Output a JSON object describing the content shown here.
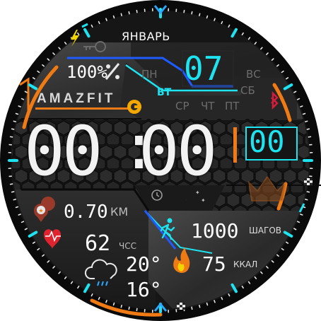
{
  "month": "ЯНВАРЬ",
  "battery": "100%",
  "brand": "AMAZFIT",
  "date_number": "07",
  "weekdays": {
    "mon": "ПН",
    "tue": "ВТ",
    "wed": "СР",
    "thu": "ЧТ",
    "fri": "ПТ",
    "sat": "СБ",
    "sun": "ВС"
  },
  "time": {
    "hours": "00",
    "separator": ":",
    "minutes": "00",
    "seconds": "00"
  },
  "distance": {
    "value": "0.70",
    "unit": "КМ"
  },
  "heart_rate": {
    "value": "62",
    "unit": "ЧСС"
  },
  "weather": {
    "temp_high": "20°",
    "temp_low": "16°"
  },
  "steps": {
    "value": "1000",
    "unit": "ШАГОВ"
  },
  "calories": {
    "value": "75",
    "unit": "ККАЛ"
  },
  "colors": {
    "accent_cyan": "#1ee3f0",
    "accent_orange": "#f07a14",
    "accent_blue": "#1e5cff",
    "bluetooth_red": "#d21e3a",
    "heart_red": "#e0242f",
    "bolt_yellow": "#f2d400"
  },
  "icons": [
    "bolt-icon",
    "key-icon",
    "battery-percent-icon",
    "bluetooth-icon",
    "location-pin-icon",
    "heart-icon",
    "weather-cloud-rain-icon",
    "walking-person-icon",
    "flame-icon",
    "alarm-clock-icon",
    "moon-stars-icon",
    "crown-icon",
    "checkered-flag-icon",
    "chevron-up-icon",
    "chevron-down-icon"
  ]
}
